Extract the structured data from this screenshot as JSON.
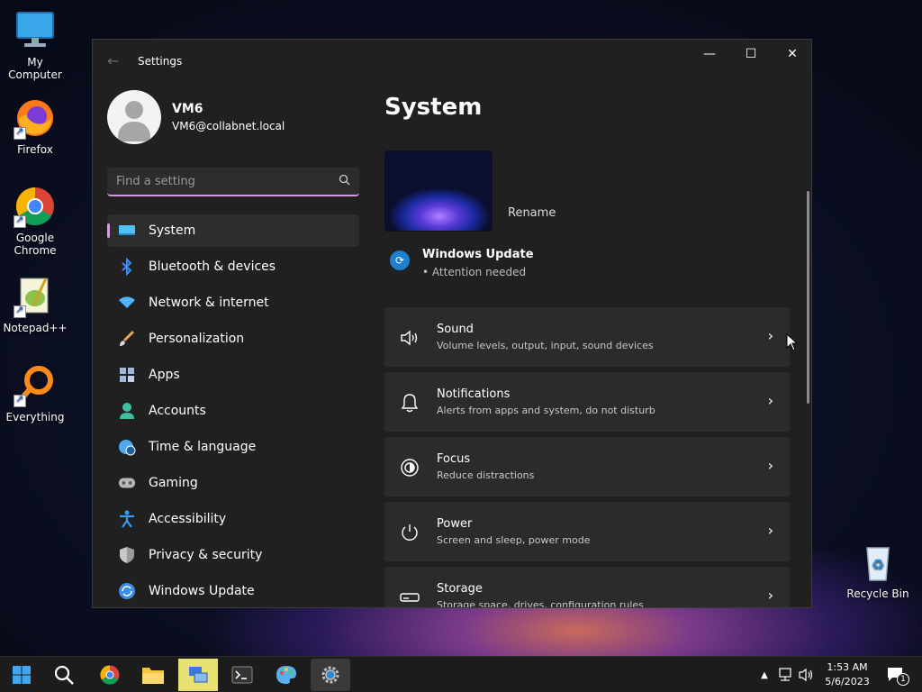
{
  "desktop": {
    "icons": [
      {
        "label": "My Computer"
      },
      {
        "label": "Firefox"
      },
      {
        "label": "Google Chrome"
      },
      {
        "label": "Notepad++"
      },
      {
        "label": "Everything"
      },
      {
        "label": "Recycle Bin"
      }
    ]
  },
  "window": {
    "title": "Settings",
    "controls": {
      "minimize": "—",
      "maximize": "☐",
      "close": "✕"
    }
  },
  "profile": {
    "name": "VM6",
    "email": "VM6@collabnet.local"
  },
  "search": {
    "placeholder": "Find a setting"
  },
  "nav": {
    "items": [
      {
        "label": "System",
        "icon": "monitor-icon",
        "color": "#4fc3f7"
      },
      {
        "label": "Bluetooth & devices",
        "icon": "bluetooth-icon",
        "color": "#3b8eea"
      },
      {
        "label": "Network & internet",
        "icon": "wifi-icon",
        "color": "#4fb3ff"
      },
      {
        "label": "Personalization",
        "icon": "brush-icon",
        "color": "#e7a35a"
      },
      {
        "label": "Apps",
        "icon": "apps-icon",
        "color": "#a0b8d8"
      },
      {
        "label": "Accounts",
        "icon": "person-icon",
        "color": "#3fbf9f"
      },
      {
        "label": "Time & language",
        "icon": "globe-clock-icon",
        "color": "#4fa8f0"
      },
      {
        "label": "Gaming",
        "icon": "gamepad-icon",
        "color": "#b8b8b8"
      },
      {
        "label": "Accessibility",
        "icon": "accessibility-icon",
        "color": "#3b9af0"
      },
      {
        "label": "Privacy & security",
        "icon": "shield-icon",
        "color": "#9a9a9a"
      },
      {
        "label": "Windows Update",
        "icon": "update-icon",
        "color": "#3b8eea"
      }
    ]
  },
  "main": {
    "title": "System",
    "rename": "Rename",
    "windows_update": {
      "title": "Windows Update",
      "status": "Attention needed"
    },
    "cards": [
      {
        "title": "Sound",
        "subtitle": "Volume levels, output, input, sound devices",
        "icon": "speaker-icon"
      },
      {
        "title": "Notifications",
        "subtitle": "Alerts from apps and system, do not disturb",
        "icon": "bell-icon"
      },
      {
        "title": "Focus",
        "subtitle": "Reduce distractions",
        "icon": "focus-icon"
      },
      {
        "title": "Power",
        "subtitle": "Screen and sleep, power mode",
        "icon": "power-icon"
      },
      {
        "title": "Storage",
        "subtitle": "Storage space, drives, configuration rules",
        "icon": "storage-icon"
      }
    ]
  },
  "taskbar": {
    "time": "1:53 AM",
    "date": "5/6/2023",
    "notification_count": "1"
  }
}
